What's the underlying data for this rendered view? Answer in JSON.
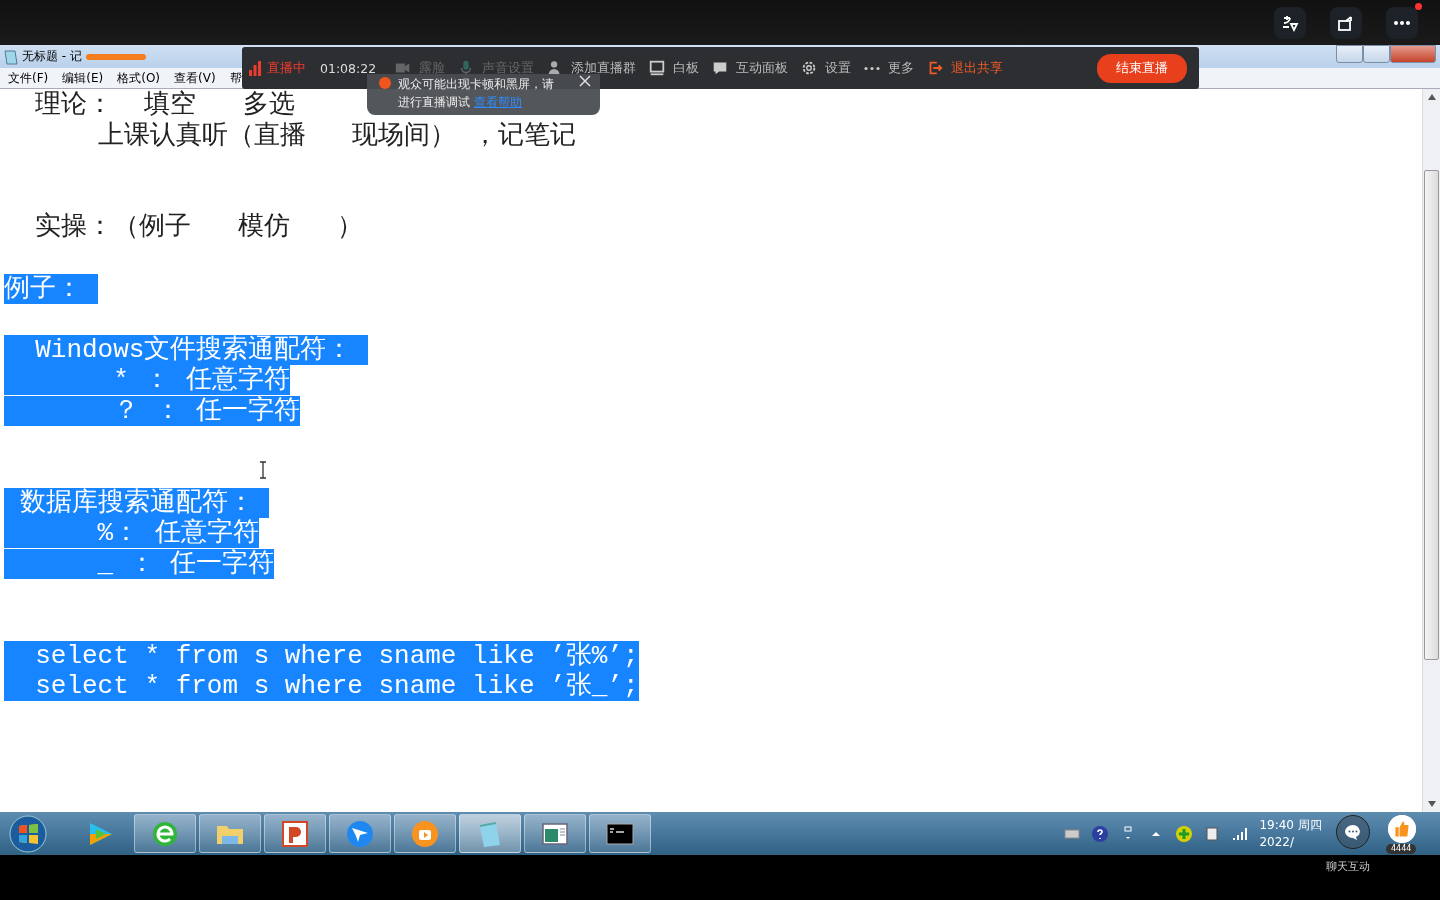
{
  "top_bar": {
    "notification": true
  },
  "window": {
    "title": "无标题 - 记"
  },
  "menu": [
    "文件(F)",
    "编辑(E)",
    "格式(O)",
    "查看(V)",
    "帮"
  ],
  "live_toolbar": {
    "status": "直播中",
    "time": "01:08:22",
    "items": [
      {
        "label": "露脸",
        "kind": "camera",
        "dimmed": true,
        "accent": false
      },
      {
        "label": "声音设置",
        "kind": "mic",
        "dimmed": true,
        "accent": false
      },
      {
        "label": "添加直播群",
        "kind": "group",
        "dimmed": false,
        "accent": false
      },
      {
        "label": "白板",
        "kind": "board",
        "dimmed": false,
        "accent": false
      },
      {
        "label": "互动面板",
        "kind": "chat",
        "dimmed": false,
        "accent": false
      },
      {
        "label": "设置",
        "kind": "gear",
        "dimmed": false,
        "accent": false
      },
      {
        "label": "更多",
        "kind": "dots",
        "dimmed": false,
        "accent": false
      },
      {
        "label": "退出共享",
        "kind": "exit",
        "dimmed": false,
        "accent": true
      }
    ],
    "end_button": "结束直播"
  },
  "toast": {
    "message_lines": [
      "观众可能出现卡顿和黑屏，请",
      "进行直播调试"
    ],
    "link": "查看帮助"
  },
  "document": {
    "lines": [
      {
        "text": "  理论：  填空   多选",
        "selected": false
      },
      {
        "text": "      上课认真听（直播   现场间） ，记笔记",
        "selected": false
      },
      {
        "kind": "blank"
      },
      {
        "kind": "blank"
      },
      {
        "text": "  实操：（例子   模仿   ）",
        "selected": false
      },
      {
        "kind": "blank"
      },
      {
        "text": "例子： ",
        "selected": true
      },
      {
        "kind": "blank"
      },
      {
        "text": "  Windows文件搜索通配符： ",
        "selected": true
      },
      {
        "text": "       * ： 任意字符",
        "selected": true
      },
      {
        "text": "       ？ ： 任一字符",
        "selected": true
      },
      {
        "kind": "blank"
      },
      {
        "kind": "blank"
      },
      {
        "text": " 数据库搜索通配符： ",
        "selected": true
      },
      {
        "text": "      %： 任意字符",
        "selected": true
      },
      {
        "text": "      _ ： 任一字符",
        "selected": true
      },
      {
        "kind": "blank"
      },
      {
        "kind": "blank"
      },
      {
        "text": "  select * from s where sname like ’张%’;",
        "selected": true
      },
      {
        "text": "  select * from s where sname like ’张_’;",
        "selected": true
      }
    ]
  },
  "taskbar": {
    "apps": [
      {
        "kind": "player",
        "open": false,
        "active": false
      },
      {
        "kind": "browser",
        "open": true,
        "active": false
      },
      {
        "kind": "folder",
        "open": true,
        "active": false
      },
      {
        "kind": "slides",
        "open": true,
        "active": false
      },
      {
        "kind": "bird",
        "open": true,
        "active": false
      },
      {
        "kind": "play",
        "open": true,
        "active": false
      },
      {
        "kind": "notepad",
        "open": true,
        "active": true
      },
      {
        "kind": "window",
        "open": true,
        "active": false
      },
      {
        "kind": "console",
        "open": true,
        "active": false
      }
    ],
    "time": "19:40",
    "weekday": "周四",
    "date": "2022/"
  },
  "overlay": {
    "likes": "4444",
    "chat_label": "聊天互动"
  }
}
